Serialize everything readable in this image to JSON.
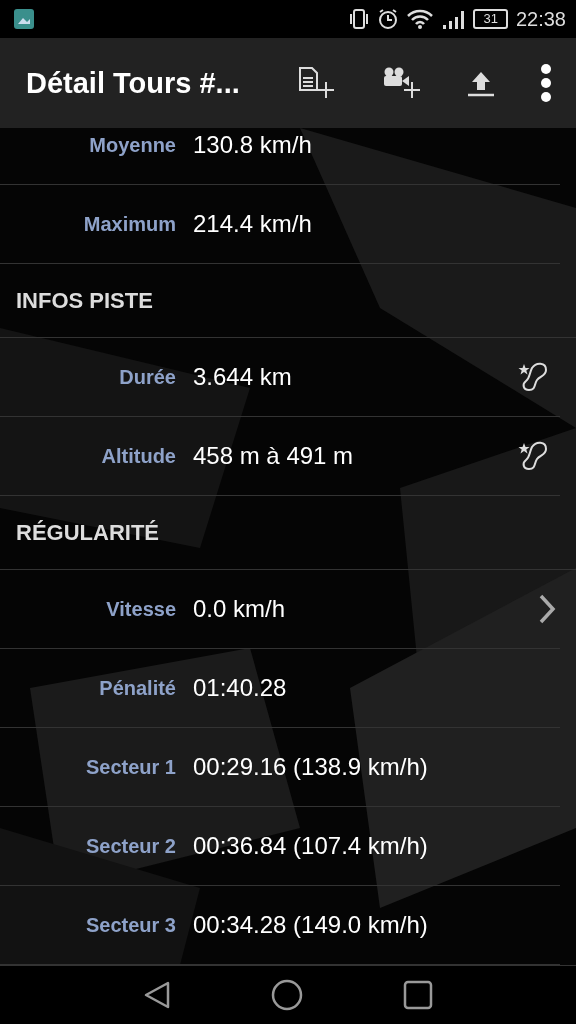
{
  "status_bar": {
    "battery": "31",
    "time": "22:38"
  },
  "app_bar": {
    "title": "Détail Tours #..."
  },
  "sections": [
    {
      "rows": [
        {
          "kind": "plain",
          "label": "Moyenne",
          "value": "130.8 km/h"
        },
        {
          "kind": "plain",
          "label": "Maximum",
          "value": "214.4 km/h"
        }
      ]
    },
    {
      "title": "INFOS PISTE",
      "rows": [
        {
          "kind": "track",
          "label": "Durée",
          "value": "3.644 km"
        },
        {
          "kind": "track",
          "label": "Altitude",
          "value": "458 m à 491 m"
        }
      ]
    },
    {
      "title": "RÉGULARITÉ",
      "rows": [
        {
          "kind": "link",
          "label": "Vitesse",
          "value": "0.0 km/h"
        },
        {
          "kind": "plain",
          "label": "Pénalité",
          "value": "01:40.28"
        },
        {
          "kind": "plain",
          "label": "Secteur 1",
          "value": "00:29.16 (138.9 km/h)"
        },
        {
          "kind": "plain",
          "label": "Secteur 2",
          "value": "00:36.84 (107.4 km/h)"
        },
        {
          "kind": "plain",
          "label": "Secteur 3",
          "value": "00:34.28 (149.0 km/h)"
        }
      ]
    }
  ]
}
